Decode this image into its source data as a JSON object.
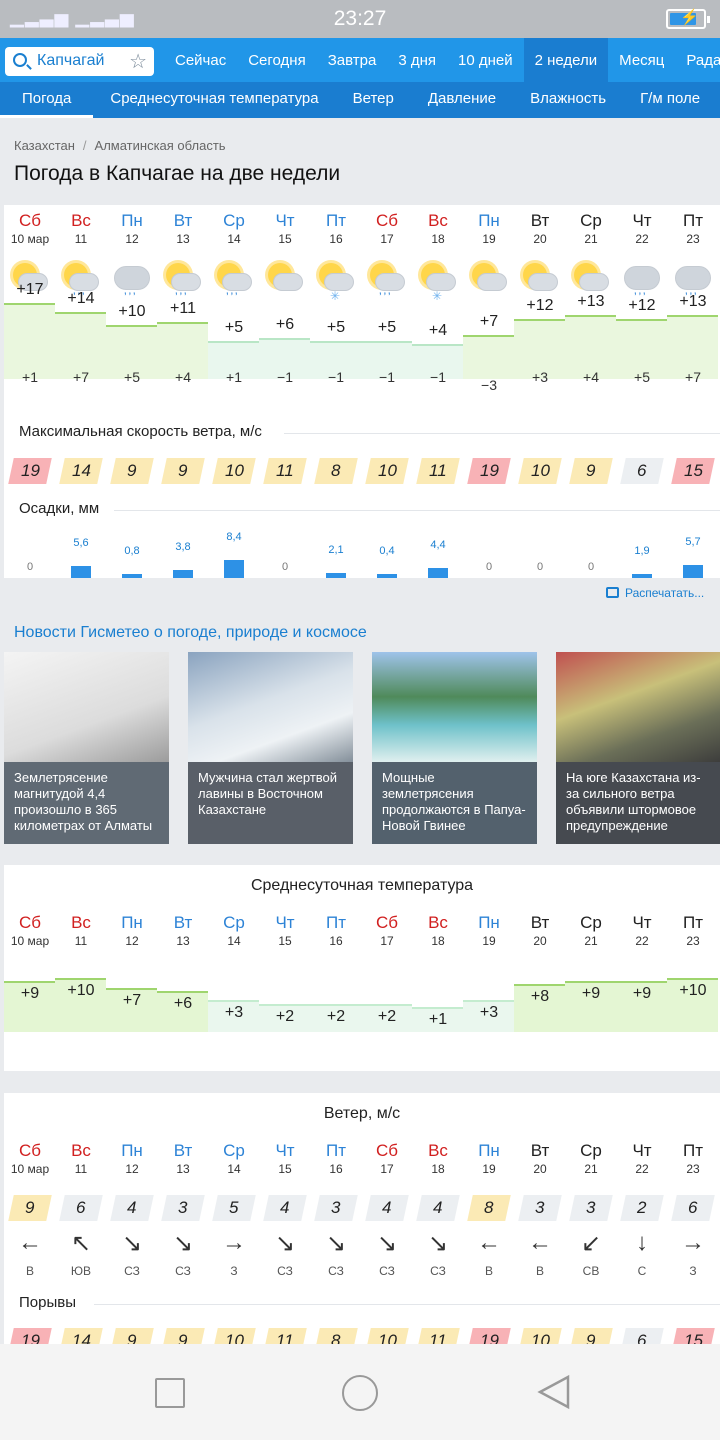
{
  "status": {
    "signal": "▁▂▃▅ ▁▂▃▅",
    "wifi_icon": "wifi-icon",
    "time": "23:27"
  },
  "search": {
    "value": "Капчагай",
    "placeholder": "Капчагай"
  },
  "tabs": [
    "Сейчас",
    "Сегодня",
    "Завтра",
    "3 дня",
    "10 дней",
    "2 недели",
    "Месяц",
    "Радар"
  ],
  "active_tab": 5,
  "subtabs": [
    "Погода",
    "Среднесуточная температура",
    "Ветер",
    "Давление",
    "Влажность",
    "Г/м поле"
  ],
  "breadcrumb": [
    "Казахстан",
    "Алматинская область"
  ],
  "page_title": "Погода в Капчагае на две недели",
  "days": [
    {
      "name": "Сб",
      "date": "10 мар",
      "color": "red"
    },
    {
      "name": "Вс",
      "date": "11",
      "color": "red"
    },
    {
      "name": "Пн",
      "date": "12",
      "color": "blue"
    },
    {
      "name": "Вт",
      "date": "13",
      "color": "blue"
    },
    {
      "name": "Ср",
      "date": "14",
      "color": "blue"
    },
    {
      "name": "Чт",
      "date": "15",
      "color": "blue"
    },
    {
      "name": "Пт",
      "date": "16",
      "color": "blue"
    },
    {
      "name": "Сб",
      "date": "17",
      "color": "red"
    },
    {
      "name": "Вс",
      "date": "18",
      "color": "red"
    },
    {
      "name": "Пн",
      "date": "19",
      "color": "blue"
    },
    {
      "name": "Вт",
      "date": "20",
      "color": "dark"
    },
    {
      "name": "Ср",
      "date": "21",
      "color": "dark"
    },
    {
      "name": "Чт",
      "date": "22",
      "color": "dark"
    },
    {
      "name": "Пт",
      "date": "23",
      "color": "dark"
    }
  ],
  "weather_icons": [
    "partly-cloudy-icon",
    "partly-cloudy-rain-icon",
    "cloudy-rain-icon",
    "partly-cloudy-rain-icon",
    "partly-cloudy-rain-icon",
    "partly-cloudy-icon",
    "partly-cloudy-snow-icon",
    "partly-cloudy-rain-icon",
    "partly-cloudy-snow-icon",
    "partly-cloudy-icon",
    "partly-cloudy-icon",
    "partly-cloudy-icon",
    "cloudy-rain-icon",
    "cloudy-rain-icon"
  ],
  "temp_max": [
    "+17",
    "+14",
    "+10",
    "+11",
    "+5",
    "+6",
    "+5",
    "+5",
    "+4",
    "+7",
    "+12",
    "+13",
    "+12",
    "+13"
  ],
  "temp_min": [
    "+1",
    "+7",
    "+5",
    "+4",
    "+1",
    "−1",
    "−1",
    "−1",
    "−1",
    "−3",
    "+3",
    "+4",
    "+5",
    "+7"
  ],
  "temp_max_num": [
    17,
    14,
    10,
    11,
    5,
    6,
    5,
    5,
    4,
    7,
    12,
    13,
    12,
    13
  ],
  "wind_title": "Максимальная скорость ветра, м/с",
  "wind_max": [
    "19",
    "14",
    "9",
    "9",
    "10",
    "11",
    "8",
    "10",
    "11",
    "19",
    "10",
    "9",
    "6",
    "15"
  ],
  "precip_title": "Осадки, мм",
  "precip": [
    "0",
    "5,6",
    "0,8",
    "3,8",
    "8,4",
    "0",
    "2,1",
    "0,4",
    "4,4",
    "0",
    "0",
    "0",
    "1,9",
    "5,7"
  ],
  "precip_num": [
    0,
    5.6,
    0.8,
    3.8,
    8.4,
    0,
    2.1,
    0.4,
    4.4,
    0,
    0,
    0,
    1.9,
    5.7
  ],
  "print_label": "Распечатать...",
  "news_title": "Новости Гисметео о погоде, природе и космосе",
  "news": [
    {
      "caption": "Землетрясение магнитудой 4,4 произошло в 365 километрах от Алматы"
    },
    {
      "caption": "Мужчина стал жертвой лавины в Восточном Казахстане"
    },
    {
      "caption": "Мощные землетрясения продолжаются в Папуа-Новой Гвинее"
    },
    {
      "caption": "На юге Казахстана из-за сильного ветра объявили штормовое предупреждение"
    }
  ],
  "avg_title": "Среднесуточная температура",
  "avg_temp": [
    "+9",
    "+10",
    "+7",
    "+6",
    "+3",
    "+2",
    "+2",
    "+2",
    "+1",
    "+3",
    "+8",
    "+9",
    "+9",
    "+10"
  ],
  "avg_num": [
    9,
    10,
    7,
    6,
    3,
    2,
    2,
    2,
    1,
    3,
    8,
    9,
    9,
    10
  ],
  "wind2_title": "Ветер, м/с",
  "wind_speed": [
    "9",
    "6",
    "4",
    "3",
    "5",
    "4",
    "3",
    "4",
    "4",
    "8",
    "3",
    "3",
    "2",
    "6"
  ],
  "wind_arrows": [
    "←",
    "↖",
    "↘",
    "↘",
    "→",
    "↘",
    "↘",
    "↘",
    "↘",
    "←",
    "←",
    "↙",
    "↓",
    "→"
  ],
  "wind_dirs": [
    "В",
    "ЮВ",
    "СЗ",
    "СЗ",
    "З",
    "СЗ",
    "СЗ",
    "СЗ",
    "СЗ",
    "В",
    "В",
    "СВ",
    "С",
    "З"
  ],
  "gusts_title": "Порывы",
  "gusts": [
    "19",
    "14",
    "9",
    "9",
    "10",
    "11",
    "8",
    "10",
    "11",
    "19",
    "10",
    "9",
    "6",
    "15"
  ]
}
